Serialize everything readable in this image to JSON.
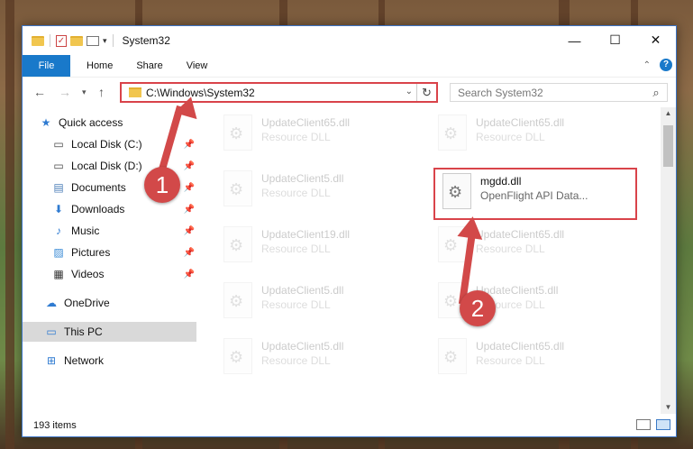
{
  "window": {
    "title": "System32"
  },
  "ribbon": {
    "tabs": [
      "File",
      "Home",
      "Share",
      "View"
    ]
  },
  "address": {
    "path": "C:\\Windows\\System32"
  },
  "search": {
    "placeholder": "Search System32"
  },
  "sidebar": {
    "items": [
      {
        "label": "Quick access",
        "icon": "star-icon",
        "pinned": false
      },
      {
        "label": "Local Disk (C:)",
        "icon": "drive-icon",
        "pinned": true
      },
      {
        "label": "Local Disk (D:)",
        "icon": "drive-icon",
        "pinned": true
      },
      {
        "label": "Documents",
        "icon": "documents-icon",
        "pinned": true
      },
      {
        "label": "Downloads",
        "icon": "download-icon",
        "pinned": true
      },
      {
        "label": "Music",
        "icon": "music-icon",
        "pinned": true
      },
      {
        "label": "Pictures",
        "icon": "pictures-icon",
        "pinned": true
      },
      {
        "label": "Videos",
        "icon": "videos-icon",
        "pinned": true
      },
      {
        "label": "OneDrive",
        "icon": "cloud-icon",
        "pinned": false
      },
      {
        "label": "This PC",
        "icon": "computer-icon",
        "pinned": false,
        "selected": true
      },
      {
        "label": "Network",
        "icon": "network-icon",
        "pinned": false
      }
    ]
  },
  "files": [
    {
      "name": "UpdateClient65.dll",
      "desc": "Resource DLL"
    },
    {
      "name": "UpdateClient65.dll",
      "desc": "Resource DLL"
    },
    {
      "name": "UpdateClient5.dll",
      "desc": "Resource DLL"
    },
    {
      "name": "mgdd.dll",
      "desc": "OpenFlight API Data..."
    },
    {
      "name": "UpdateClient19.dll",
      "desc": "Resource DLL"
    },
    {
      "name": "UpdateClient65.dll",
      "desc": "Resource DLL"
    },
    {
      "name": "UpdateClient5.dll",
      "desc": "Resource DLL"
    },
    {
      "name": "UpdateClient5.dll",
      "desc": "Resource DLL"
    },
    {
      "name": "UpdateClient5.dll",
      "desc": "Resource DLL"
    },
    {
      "name": "UpdateClient65.dll",
      "desc": "Resource DLL"
    }
  ],
  "status": {
    "count": "193 items"
  },
  "callouts": {
    "one": "1",
    "two": "2"
  },
  "colors": {
    "accent": "#1979ca",
    "highlight": "#d9434a",
    "callout": "#d24949"
  }
}
